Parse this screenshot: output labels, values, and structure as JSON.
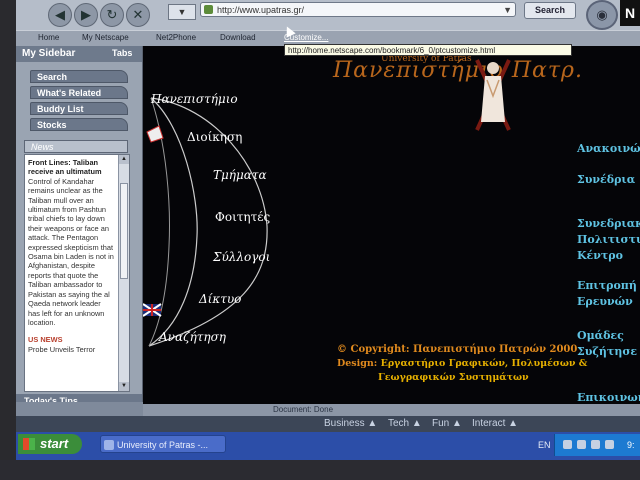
{
  "toolbar": {
    "back_icon": "back-arrow-icon",
    "forward_icon": "forward-arrow-icon",
    "reload_icon": "reload-icon",
    "stop_icon": "stop-icon",
    "url": "http://www.upatras.gr/",
    "search_label": "Search",
    "logo_letter": "N"
  },
  "personal_toolbar": {
    "home": "Home",
    "my_netscape": "My Netscape",
    "net2phone": "Net2Phone",
    "download": "Download",
    "customize": "Customize..."
  },
  "tooltip": "http://home.netscape.com/bookmark/6_0/ptcustomize.html",
  "sidebar": {
    "title": "My Sidebar",
    "tabs_label": "Tabs",
    "tabs": [
      "Search",
      "What's Related",
      "Buddy List",
      "Stocks"
    ],
    "news_tab": "News",
    "headline": "Front Lines: Taliban receive an ultimatum",
    "body": "Control of Kandahar remains unclear as the Taliban mull over an ultimatum from Pashtun tribal chiefs to lay down their weapons or face an attack. The Pentagon expressed skepticism that Osama bin Laden is not in Afghanistan, despite reports that quote the Taliban ambassador to Pakistan as saying the al Qaeda network leader has left for an unknown location.",
    "us_news": "US NEWS",
    "probe": "Probe Unveils Terror",
    "tips": "Today's Tips"
  },
  "site": {
    "logo_sub": "University of Patras",
    "logo_title": "Πανεπιστήμιο Πατρ.",
    "menu": [
      "Πανεπιστήμιο",
      "Διοίκηση",
      "Τμήματα",
      "Φοιτητές",
      "Σύλλογοι",
      "Δίκτυο",
      "Αναζήτηση"
    ],
    "right_links": [
      "Ανακοινώσ",
      "Συνέδρια",
      "Συνεδριακό",
      "Πολιτιστικ",
      "Κέντρο",
      "Επιτροπή",
      "Ερευνών",
      "Ομάδες",
      "Συζήτησε",
      "Επικοινων"
    ],
    "copyright": "© Copyright: Πανεπιστήμιο Πατρών 2000",
    "design_label": "Design:",
    "design_value": "Εργαστήριο Γραφικών, Πολυμέσων &",
    "design_value2": "Γεωγραφικών Συστημάτων"
  },
  "statusbar": "Document: Done",
  "bottom_bar": {
    "business": "Business ▲",
    "tech": "Tech ▲",
    "fun": "Fun ▲",
    "interact": "Interact ▲"
  },
  "taskbar": {
    "start": "start",
    "task": "University of Patras -...",
    "lang": "EN",
    "clock": "9:"
  },
  "colors": {
    "menu_text": "#ffffff",
    "right_links": "#5fc3e3",
    "copyright": "#e08a1e",
    "logo": "#b8661c"
  }
}
